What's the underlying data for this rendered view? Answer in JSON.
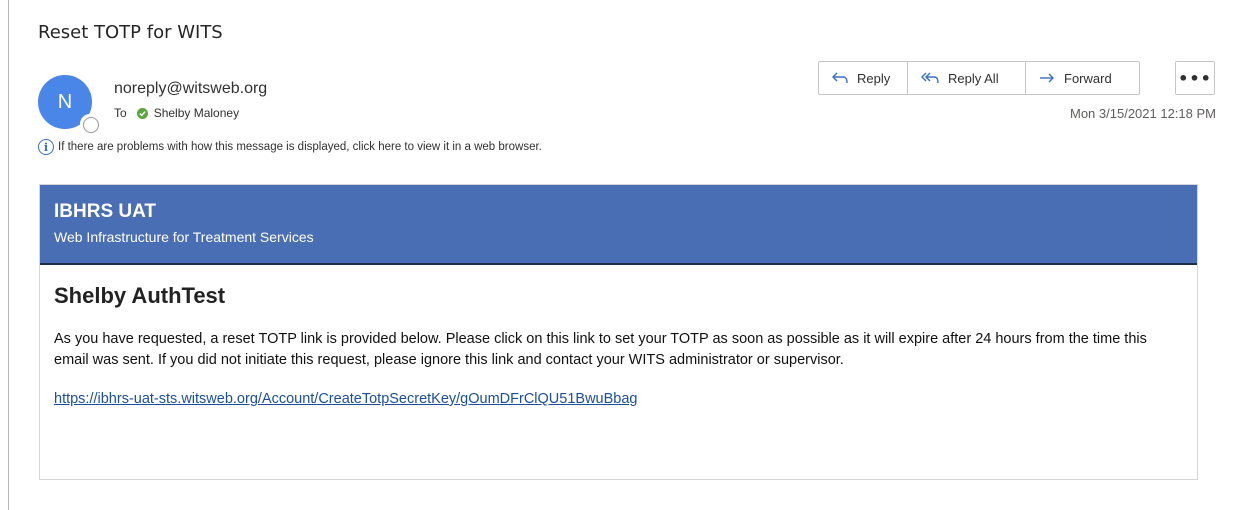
{
  "email": {
    "subject": "Reset TOTP for WITS",
    "avatar_initial": "N",
    "sender": "noreply@witsweb.org",
    "to_label": "To",
    "recipient": "Shelby Maloney",
    "info_message": "If there are problems with how this message is displayed, click here to view it in a web browser.",
    "date": "Mon 3/15/2021 12:18 PM"
  },
  "actions": {
    "reply_label": "Reply",
    "reply_all_label": "Reply All",
    "forward_label": "Forward",
    "more_label": "•••"
  },
  "content": {
    "org_name": "IBHRS UAT",
    "org_subtitle": "Web Infrastructure for Treatment Services",
    "greeting_name": "Shelby AuthTest",
    "message": "As you have requested, a reset TOTP link is provided below. Please click on this link to set your TOTP as soon as possible as it will expire after 24 hours from the time this email was sent. If you did not initiate this request, please ignore this link and contact your WITS administrator or supervisor.",
    "reset_link": "https://ibhrs-uat-sts.witsweb.org/Account/CreateTotpSecretKey/gOumDFrClQU51BwuBbag"
  },
  "colors": {
    "header_bg": "#4a6eb4",
    "avatar_bg": "#4a86e8",
    "link": "#1b4f9c",
    "presence_ok": "#5ba63a"
  },
  "icons": [
    "info-icon",
    "reply-icon",
    "reply-all-icon",
    "forward-icon",
    "more-icon",
    "presence-icon",
    "available-status-icon"
  ]
}
